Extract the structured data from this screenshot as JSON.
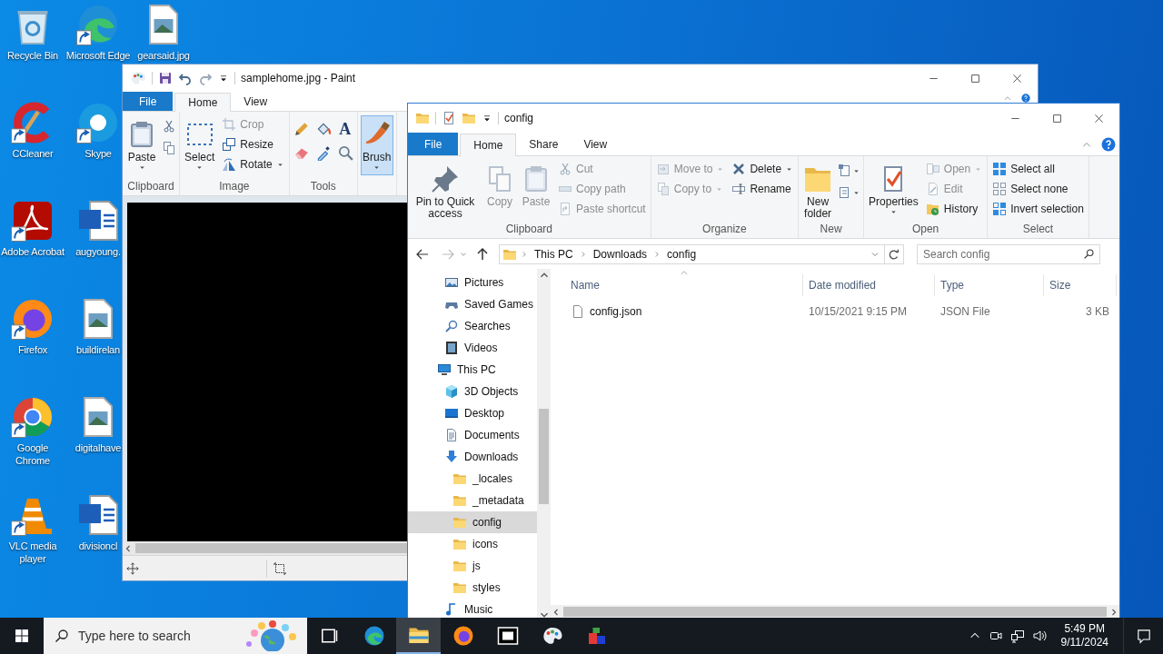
{
  "desktop": {
    "icons": [
      {
        "label": "Recycle Bin",
        "kind": "recycle",
        "shortcut": false
      },
      {
        "label": "CCleaner",
        "kind": "ccleaner",
        "shortcut": true
      },
      {
        "label": "Adobe Acrobat",
        "kind": "acrobat",
        "shortcut": true
      },
      {
        "label": "Firefox",
        "kind": "firefox",
        "shortcut": true
      },
      {
        "label": "Google Chrome",
        "kind": "chrome",
        "shortcut": true
      },
      {
        "label": "VLC media player",
        "kind": "vlc",
        "shortcut": true
      },
      {
        "label": "Microsoft Edge",
        "kind": "edge",
        "shortcut": true
      },
      {
        "label": "Skype",
        "kind": "skype",
        "shortcut": true
      },
      {
        "label": "augyoung.",
        "kind": "word",
        "shortcut": false
      },
      {
        "label": "buildirelan",
        "kind": "image",
        "shortcut": false
      },
      {
        "label": "digitalhave",
        "kind": "image",
        "shortcut": false
      },
      {
        "label": "divisioncl",
        "kind": "word",
        "shortcut": false
      },
      {
        "label": "gearsaid.jpg",
        "kind": "image",
        "shortcut": false
      }
    ]
  },
  "paint": {
    "title": "samplehome.jpg - Paint",
    "tabs": [
      {
        "label": "File",
        "kind": "file",
        "selected": false
      },
      {
        "label": "Home",
        "kind": "tab",
        "selected": true
      },
      {
        "label": "View",
        "kind": "tab",
        "selected": false
      }
    ],
    "ribbon": [
      {
        "label": "Clipboard",
        "items": [
          {
            "kind": "paste",
            "label": "Paste",
            "dropdown": true,
            "disabled": false,
            "selected": false
          },
          {
            "kind": "stack",
            "items": [
              {
                "kind": "cut",
                "disabled": false,
                "dropdown": false
              },
              {
                "kind": "copy",
                "disabled": false,
                "dropdown": false
              }
            ]
          }
        ]
      },
      {
        "label": "Image",
        "items": [
          {
            "kind": "select",
            "label": "Select",
            "dropdown": true,
            "disabled": false,
            "selected": false
          },
          {
            "kind": "list",
            "items": [
              {
                "kind": "crop",
                "label": "Crop",
                "disabled": true,
                "dropdown": false
              },
              {
                "kind": "resize",
                "label": "Resize",
                "disabled": false,
                "dropdown": false
              },
              {
                "kind": "rotate",
                "label": "Rotate",
                "disabled": false,
                "dropdown": true
              }
            ]
          }
        ]
      },
      {
        "label": "Tools",
        "items": [
          {
            "kind": "grid",
            "items": [
              {
                "kind": "pencil"
              },
              {
                "kind": "fill"
              },
              {
                "kind": "text",
                "glyph": "A"
              },
              {
                "kind": "eraser"
              },
              {
                "kind": "picker"
              },
              {
                "kind": "magnifier"
              }
            ]
          }
        ]
      },
      {
        "items": [
          {
            "kind": "brush",
            "label": "Brush",
            "dropdown": true,
            "disabled": false,
            "selected": true
          }
        ]
      }
    ]
  },
  "explorer": {
    "title": "config",
    "tabs": [
      {
        "label": "File",
        "kind": "file",
        "selected": false
      },
      {
        "label": "Home",
        "kind": "tab",
        "selected": true
      },
      {
        "label": "Share",
        "kind": "tab",
        "selected": false
      },
      {
        "label": "View",
        "kind": "tab",
        "selected": false
      }
    ],
    "ribbon": [
      {
        "label": "Clipboard",
        "items": [
          {
            "kind": "pin",
            "label": "Pin to Quick access",
            "disabled": false,
            "selected": false
          },
          {
            "kind": "copy",
            "label": "Copy",
            "dropdown": false,
            "disabled": true,
            "selected": false
          },
          {
            "kind": "paste",
            "label": "Paste",
            "dropdown": false,
            "disabled": true,
            "selected": false
          },
          {
            "kind": "list",
            "items": [
              {
                "kind": "cut",
                "label": "Cut",
                "disabled": true,
                "dropdown": false
              },
              {
                "kind": "copypath",
                "label": "Copy path",
                "disabled": true,
                "dropdown": false
              },
              {
                "kind": "pasteshortcut",
                "label": "Paste shortcut",
                "disabled": true,
                "dropdown": false
              }
            ]
          }
        ]
      },
      {
        "label": "Organize",
        "items": [
          {
            "kind": "list",
            "items": [
              {
                "kind": "moveto",
                "label": "Move to",
                "disabled": true,
                "dropdown": true
              },
              {
                "kind": "copyto",
                "label": "Copy to",
                "disabled": true,
                "dropdown": true
              }
            ]
          },
          {
            "kind": "list",
            "items": [
              {
                "kind": "delete",
                "label": "Delete",
                "disabled": false,
                "dropdown": true
              },
              {
                "kind": "rename",
                "label": "Rename",
                "disabled": false,
                "dropdown": false
              }
            ]
          }
        ]
      },
      {
        "label": "New",
        "items": [
          {
            "kind": "newfolder",
            "label": "New folder",
            "disabled": false,
            "selected": false
          },
          {
            "kind": "stack",
            "items": [
              {
                "kind": "newitem",
                "disabled": false,
                "dropdown": true
              },
              {
                "kind": "easyaccess",
                "disabled": false,
                "dropdown": true
              }
            ]
          }
        ]
      },
      {
        "label": "Open",
        "items": [
          {
            "kind": "properties",
            "label": "Properties",
            "dropdown": true,
            "disabled": false,
            "selected": false
          },
          {
            "kind": "list",
            "items": [
              {
                "kind": "open",
                "label": "Open",
                "disabled": true,
                "dropdown": true
              },
              {
                "kind": "edit",
                "label": "Edit",
                "disabled": true,
                "dropdown": false
              },
              {
                "kind": "history",
                "label": "History",
                "disabled": false,
                "dropdown": false
              }
            ]
          }
        ]
      },
      {
        "label": "Select",
        "items": [
          {
            "kind": "list",
            "items": [
              {
                "kind": "selectall",
                "label": "Select all",
                "disabled": false,
                "dropdown": false
              },
              {
                "kind": "selectnone",
                "label": "Select none",
                "disabled": false,
                "dropdown": false
              },
              {
                "kind": "invert",
                "label": "Invert selection",
                "disabled": false,
                "dropdown": false
              }
            ]
          }
        ]
      }
    ],
    "address": {
      "segments": [
        "This PC",
        "Downloads",
        "config"
      ],
      "search_placeholder": "Search config"
    },
    "nav": {
      "items": [
        {
          "label": "Pictures",
          "kind": "pictures",
          "selected": false
        },
        {
          "label": "Saved Games",
          "kind": "games",
          "selected": false
        },
        {
          "label": "Searches",
          "kind": "search",
          "selected": false
        },
        {
          "label": "Videos",
          "kind": "videos",
          "selected": false
        }
      ],
      "tree": [
        {
          "label": "This PC",
          "kind": "pc",
          "selected": false,
          "children": [
            {
              "label": "3D Objects",
              "kind": "objects3d",
              "selected": false
            },
            {
              "label": "Desktop",
              "kind": "desktop",
              "selected": false
            },
            {
              "label": "Documents",
              "kind": "documents",
              "selected": false
            },
            {
              "label": "Downloads",
              "kind": "downloads",
              "selected": false,
              "children": [
                {
                  "label": "_locales",
                  "kind": "folder",
                  "selected": false
                },
                {
                  "label": "_metadata",
                  "kind": "folder",
                  "selected": false
                },
                {
                  "label": "config",
                  "kind": "folder",
                  "selected": true
                },
                {
                  "label": "icons",
                  "kind": "folder",
                  "selected": false
                },
                {
                  "label": "js",
                  "kind": "folder",
                  "selected": false
                },
                {
                  "label": "styles",
                  "kind": "folder",
                  "selected": false
                }
              ]
            },
            {
              "label": "Music",
              "kind": "music",
              "selected": false
            }
          ]
        }
      ]
    },
    "columns": [
      {
        "label": "Name",
        "sorted": true
      },
      {
        "label": "Date modified",
        "sorted": false
      },
      {
        "label": "Type",
        "sorted": false
      },
      {
        "label": "Size",
        "sorted": false
      }
    ],
    "rows": [
      {
        "name": "config.json",
        "date": "10/15/2021 9:15 PM",
        "type": "JSON File",
        "size": "3 KB",
        "selected": false
      }
    ]
  },
  "taskbar": {
    "search_placeholder": "Type here to search",
    "apps": [
      {
        "kind": "taskview",
        "active": false
      },
      {
        "kind": "edge",
        "active": false
      },
      {
        "kind": "explorer",
        "active": true
      },
      {
        "kind": "firefox",
        "active": false
      },
      {
        "kind": "archiver",
        "active": false
      },
      {
        "kind": "paint",
        "active": false
      },
      {
        "kind": "blocks",
        "active": false
      }
    ],
    "time": "5:49 PM",
    "date": "9/11/2024"
  }
}
